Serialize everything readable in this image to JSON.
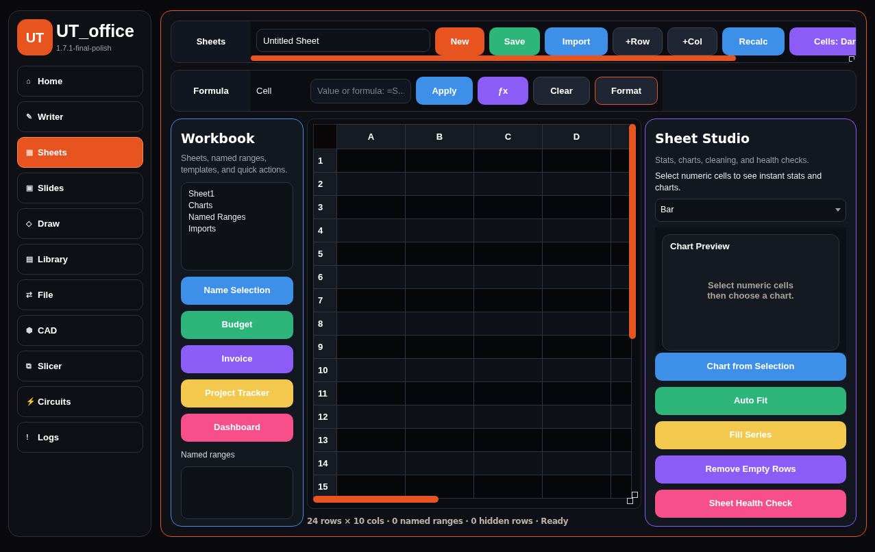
{
  "app": {
    "logo": "UT",
    "title": "UT_office",
    "version": "1.7.1-final-polish"
  },
  "nav": [
    {
      "icon": "⌂",
      "label": "Home",
      "selected": false
    },
    {
      "icon": "✎",
      "label": "Writer",
      "selected": false
    },
    {
      "icon": "▦",
      "label": "Sheets",
      "selected": true
    },
    {
      "icon": "▣",
      "label": "Slides",
      "selected": false
    },
    {
      "icon": "◇",
      "label": "Draw",
      "selected": false
    },
    {
      "icon": "▤",
      "label": "Library",
      "selected": false
    },
    {
      "icon": "⇄",
      "label": "File",
      "selected": false
    },
    {
      "icon": "⬢",
      "label": "CAD",
      "selected": false
    },
    {
      "icon": "⧉",
      "label": "Slicer",
      "selected": false
    },
    {
      "icon": "⚡",
      "label": "Circuits",
      "selected": false
    },
    {
      "icon": "!",
      "label": "Logs",
      "selected": false
    }
  ],
  "sheets_bar": {
    "label": "Sheets",
    "name_value": "Untitled Sheet",
    "buttons": [
      {
        "label": "New",
        "color": "#e8541f"
      },
      {
        "label": "Save",
        "color": "#2db57a"
      },
      {
        "label": "Import",
        "color": "#3d8fe8"
      },
      {
        "label": "+Row",
        "color": "#1f2532"
      },
      {
        "label": "+Col",
        "color": "#1f2532"
      },
      {
        "label": "Recalc",
        "color": "#3d8fe8"
      },
      {
        "label": "Cells: Dar",
        "color": "#8b5cf6"
      }
    ]
  },
  "formula_bar": {
    "label": "Formula",
    "cell_label": "Cell",
    "placeholder": "Value or formula: =S...",
    "buttons": [
      {
        "label": "Apply",
        "color": "#3d8fe8",
        "focused": false
      },
      {
        "label": "ƒx",
        "color": "#8b5cf6",
        "focused": false
      },
      {
        "label": "Clear",
        "color": "#1f2532",
        "focused": false
      },
      {
        "label": "Format",
        "color": "#1f2532",
        "focused": true
      }
    ]
  },
  "workbook": {
    "title": "Workbook",
    "subtitle": "Sheets, named ranges, templates, and quick actions.",
    "sheets": [
      "Sheet1",
      "Charts",
      "Named Ranges",
      "Imports"
    ],
    "buttons": [
      {
        "label": "Name Selection",
        "color": "#3d8fe8"
      },
      {
        "label": "Budget",
        "color": "#2db57a"
      },
      {
        "label": "Invoice",
        "color": "#8b5cf6"
      },
      {
        "label": "Project Tracker",
        "color": "#f2c94c"
      },
      {
        "label": "Dashboard",
        "color": "#f64f8a"
      }
    ],
    "named_ranges_label": "Named ranges"
  },
  "grid": {
    "columns": [
      "A",
      "B",
      "C",
      "D"
    ],
    "rows": [
      "1",
      "2",
      "3",
      "4",
      "5",
      "6",
      "7",
      "8",
      "9",
      "10",
      "11",
      "12",
      "13",
      "14",
      "15"
    ]
  },
  "status_bar": "24 rows × 10 cols · 0 named ranges · 0 hidden rows · Ready",
  "studio": {
    "title": "Sheet Studio",
    "subtitle": "Stats, charts, cleaning, and health checks.",
    "hint": "Select numeric cells to see instant stats and charts.",
    "chart_type": "Bar",
    "preview_title": "Chart Preview",
    "preview_message": "Select numeric cells\nthen choose a chart.",
    "buttons": [
      {
        "label": "Chart from Selection",
        "color": "#3d8fe8"
      },
      {
        "label": "Auto Fit",
        "color": "#2db57a"
      },
      {
        "label": "Fill Series",
        "color": "#f2c94c"
      },
      {
        "label": "Remove Empty Rows",
        "color": "#8b5cf6"
      },
      {
        "label": "Sheet Health Check",
        "color": "#f64f8a"
      }
    ]
  }
}
